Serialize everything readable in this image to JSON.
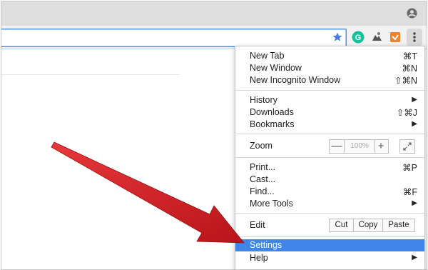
{
  "menu": {
    "items": [
      {
        "label": "New Tab",
        "shortcut": "⌘T"
      },
      {
        "label": "New Window",
        "shortcut": "⌘N"
      },
      {
        "label": "New Incognito Window",
        "shortcut": "⇧⌘N"
      },
      {
        "label": "History",
        "shortcut": "▶"
      },
      {
        "label": "Downloads",
        "shortcut": "⇧⌘J"
      },
      {
        "label": "Bookmarks",
        "shortcut": "▶"
      },
      {
        "label": "Zoom"
      },
      {
        "label": "Print...",
        "shortcut": "⌘P"
      },
      {
        "label": "Cast..."
      },
      {
        "label": "Find...",
        "shortcut": "⌘F"
      },
      {
        "label": "More Tools",
        "shortcut": "▶"
      },
      {
        "label": "Edit"
      },
      {
        "label": "Settings"
      },
      {
        "label": "Help",
        "shortcut": "▶"
      }
    ],
    "zoom": {
      "minus": "—",
      "value": "100%",
      "plus": "+"
    },
    "edit": {
      "cut": "Cut",
      "copy": "Copy",
      "paste": "Paste"
    }
  },
  "icons": {
    "profile": "profile-icon",
    "star": "bookmark-star-icon",
    "ext1": "grammarly-icon",
    "ext2": "extension-icon",
    "ext3": "shield-extension-icon",
    "menu": "kebab-menu-icon",
    "fullscreen": "fullscreen-icon"
  },
  "colors": {
    "highlight": "#3f86e8",
    "arrow": "#d61f22",
    "omnibox_border": "#4a90e2"
  }
}
